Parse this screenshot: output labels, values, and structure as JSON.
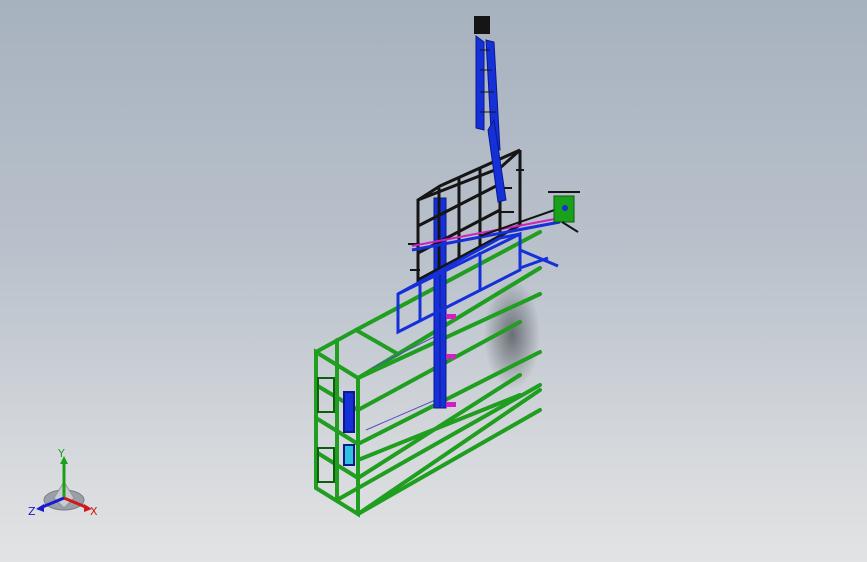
{
  "viewport": {
    "background_top": "#a7b2bf",
    "background_bottom": "#e2e3e4"
  },
  "model": {
    "colors": {
      "frame_green": "#1f9e1f",
      "frame_green_dark": "#0d5e0d",
      "conveyor_blue": "#1530d8",
      "conveyor_blue_dark": "#0a1a8a",
      "rack_black": "#151515",
      "accent_magenta": "#d020c0",
      "accent_cyan": "#30c0e0",
      "shadow": "#6e7278"
    },
    "parts": [
      "base-frame-green",
      "front-bracket-green",
      "horizontal-rails-green",
      "vertical-column-blue",
      "upper-frame-blue",
      "vertical-conveyor-blue",
      "storage-rack-black",
      "arm-assembly",
      "gripper-head"
    ]
  },
  "triad": {
    "labels": {
      "y": "Y",
      "z": "Z",
      "x": "X"
    },
    "colors": {
      "y": "#1aa01a",
      "z": "#1a1ad0",
      "x": "#d01a1a"
    },
    "icon": "coordinate-triad-icon"
  }
}
